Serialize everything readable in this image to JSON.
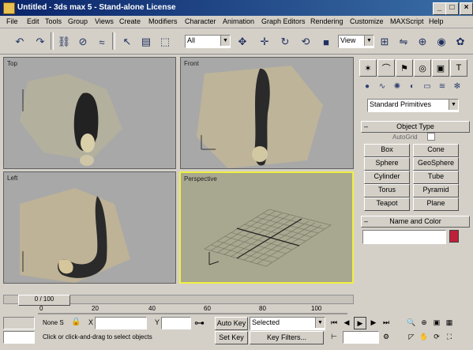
{
  "window": {
    "title": "Untitled - 3ds max 5 - Stand-alone License",
    "minimize": "_",
    "maximize": "□",
    "close": "×"
  },
  "menu": [
    "File",
    "Edit",
    "Tools",
    "Group",
    "Views",
    "Create",
    "Modifiers",
    "Character",
    "Animation",
    "Graph Editors",
    "Rendering",
    "Customize",
    "MAXScript",
    "Help"
  ],
  "toolbar": {
    "selection_filter": "All",
    "ref_coord": "View"
  },
  "viewports": {
    "top": "Top",
    "front": "Front",
    "left": "Left",
    "perspective": "Perspective"
  },
  "command_panel": {
    "category_dropdown": "Standard Primitives",
    "object_type_header": "Object Type",
    "autogrid_label": "AutoGrid",
    "object_buttons": [
      "Box",
      "Cone",
      "Sphere",
      "GeoSphere",
      "Cylinder",
      "Tube",
      "Torus",
      "Pyramid",
      "Teapot",
      "Plane"
    ],
    "name_color_header": "Name and Color",
    "object_color": "#c0203a"
  },
  "timeline": {
    "frame_slider": "0 / 100",
    "ticks": [
      "0",
      "20",
      "40",
      "60",
      "80",
      "100"
    ]
  },
  "status": {
    "none_selected": "None S",
    "x_label": "X",
    "y_label": "Y",
    "prompt": "Click or click-and-drag to select objects",
    "auto_key": "Auto Key",
    "set_key": "Set Key",
    "key_mode": "Selected",
    "key_filters": "Key Filters..."
  }
}
